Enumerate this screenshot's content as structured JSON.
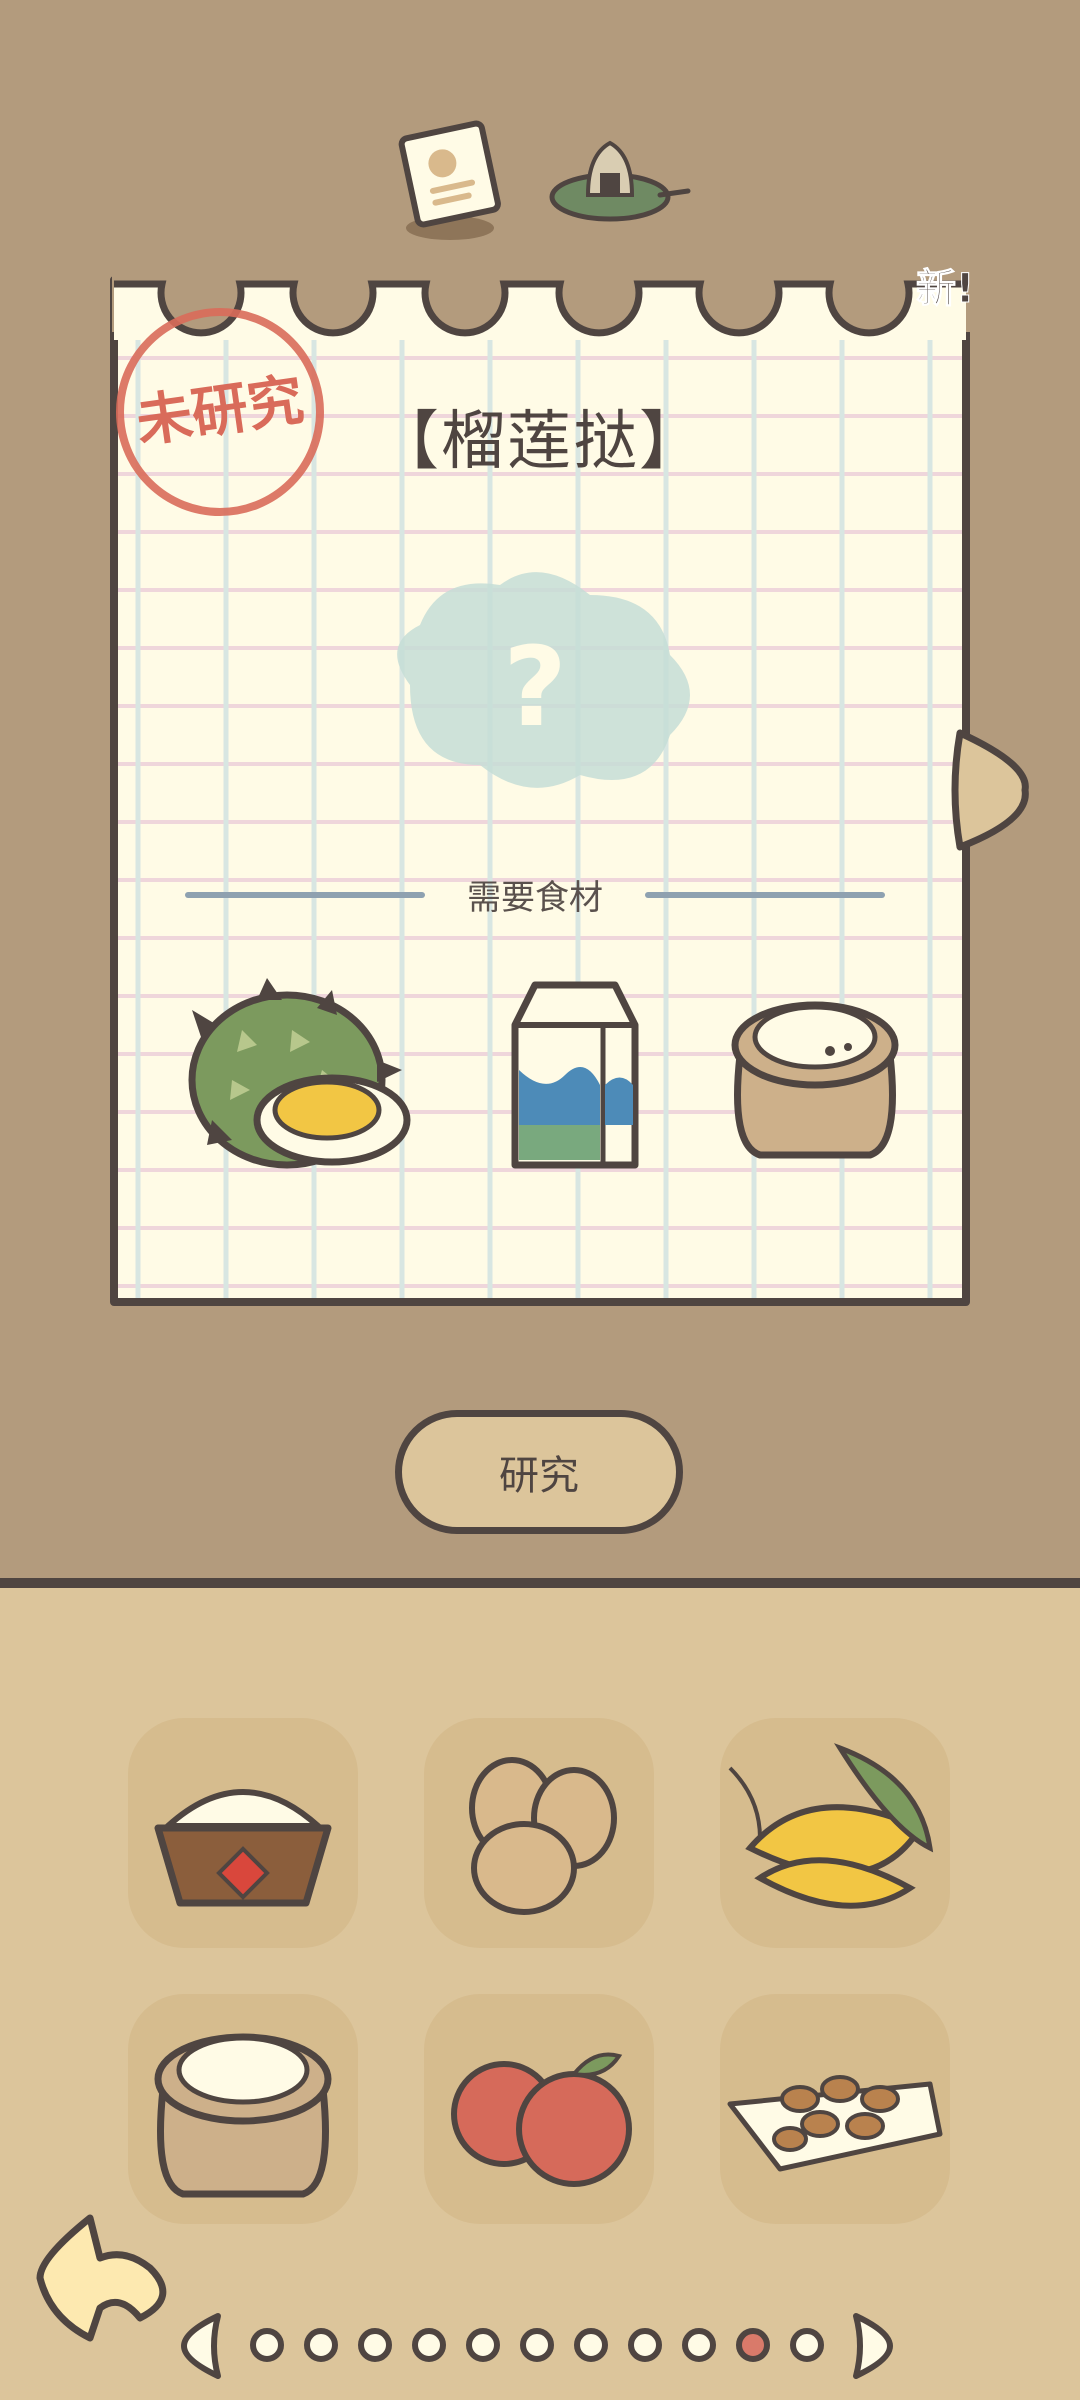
{
  "recipe": {
    "title": "【榴莲挞】",
    "status_stamp": "未研究",
    "new_badge": "新!",
    "ingredients_label": "需要食材",
    "ingredients": [
      {
        "name": "durian-icon"
      },
      {
        "name": "milk-carton-icon"
      },
      {
        "name": "flour-sack-icon"
      }
    ]
  },
  "actions": {
    "research_label": "研究"
  },
  "inventory": {
    "items": [
      {
        "name": "rice-bowl-icon"
      },
      {
        "name": "eggs-icon"
      },
      {
        "name": "corn-icon"
      },
      {
        "name": "flour-sack-icon"
      },
      {
        "name": "apples-icon"
      },
      {
        "name": "nuts-icon"
      }
    ]
  },
  "pager": {
    "total_pages": 11,
    "current_page": 10
  },
  "colors": {
    "background_top": "#b39b7d",
    "background_bottom": "#dcc59b",
    "outline": "#4f4541",
    "paper": "#fffbe6",
    "stamp_red": "#d96b5a"
  }
}
